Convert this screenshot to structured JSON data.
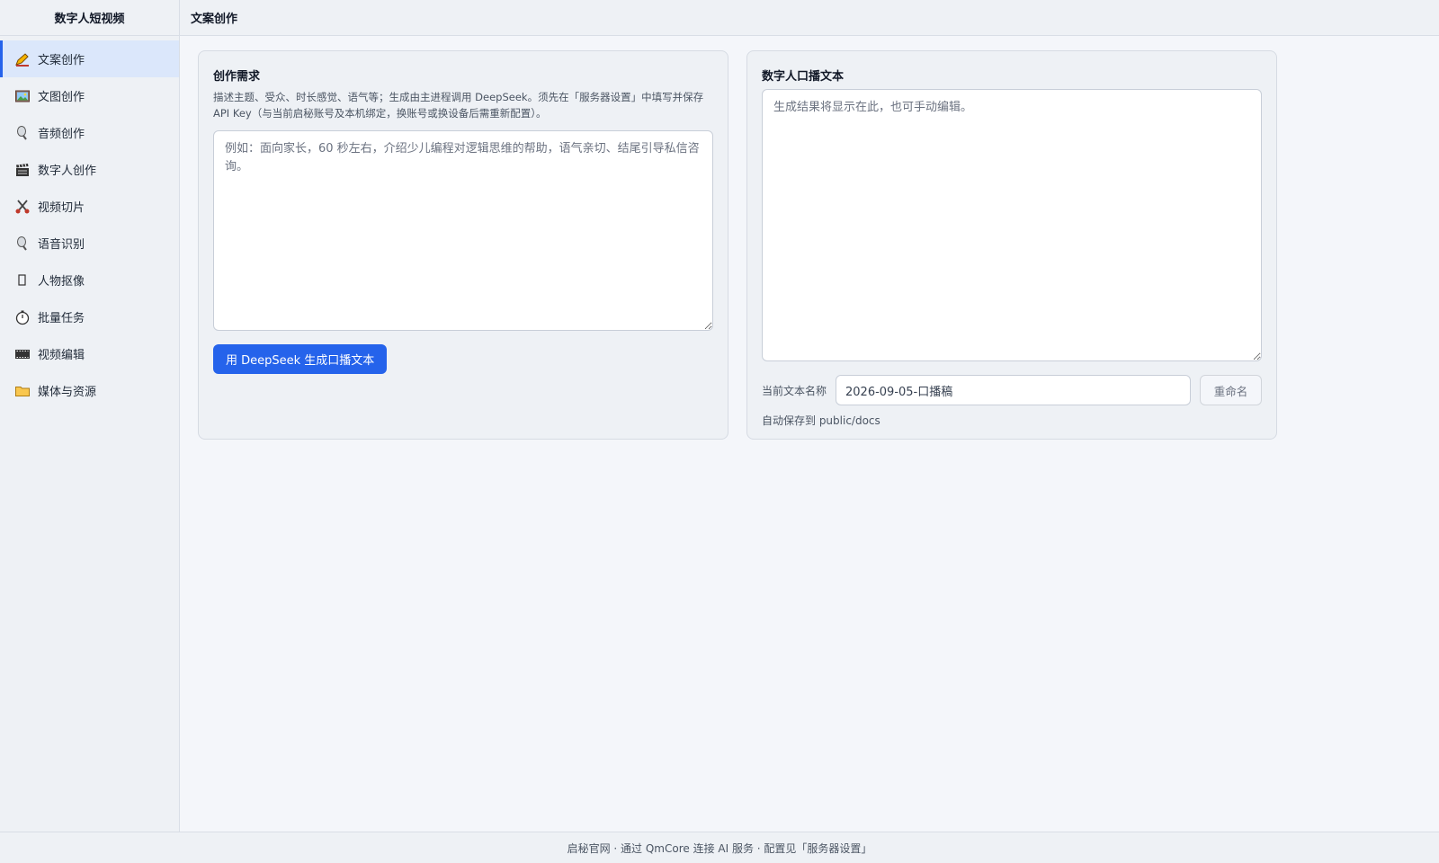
{
  "app": {
    "title": "数字人短视频"
  },
  "header": {
    "title": "文案创作"
  },
  "sidebar": {
    "items": [
      {
        "label": "文案创作",
        "icon": "pencil-icon",
        "active": true
      },
      {
        "label": "文图创作",
        "icon": "picture-icon",
        "active": false
      },
      {
        "label": "音频创作",
        "icon": "microphone-icon",
        "active": false
      },
      {
        "label": "数字人创作",
        "icon": "clapperboard-icon",
        "active": false
      },
      {
        "label": "视频切片",
        "icon": "scissors-icon",
        "active": false
      },
      {
        "label": "语音识别",
        "icon": "microphone-icon",
        "active": false
      },
      {
        "label": "人物抠像",
        "icon": "rectangle-icon",
        "active": false
      },
      {
        "label": "批量任务",
        "icon": "stopwatch-icon",
        "active": false
      },
      {
        "label": "视频编辑",
        "icon": "film-strip-icon",
        "active": false
      },
      {
        "label": "媒体与资源",
        "icon": "folder-icon",
        "active": false
      }
    ]
  },
  "request_panel": {
    "title": "创作需求",
    "description": "描述主题、受众、时长感觉、语气等；生成由主进程调用 DeepSeek。须先在「服务器设置」中填写并保存 API Key（与当前启秘账号及本机绑定，换账号或换设备后需重新配置）。",
    "input_value": "",
    "input_placeholder": "例如：面向家长，60 秒左右，介绍少儿编程对逻辑思维的帮助，语气亲切、结尾引导私信咨询。",
    "generate_label": "用 DeepSeek 生成口播文本"
  },
  "script_panel": {
    "title": "数字人口播文本",
    "output_value": "",
    "output_placeholder": "生成结果将显示在此，也可手动编辑。",
    "name_label": "当前文本名称",
    "name_value": "2026-09-05-口播稿",
    "rename_label": "重命名",
    "autosave_text": "自动保存到 public/docs"
  },
  "footer": {
    "text": "启秘官网 · 通过 QmCore 连接 AI 服务 · 配置见「服务器设置」"
  },
  "colors": {
    "accent": "#2563eb",
    "active_nav_bg": "#dbe7fb"
  }
}
